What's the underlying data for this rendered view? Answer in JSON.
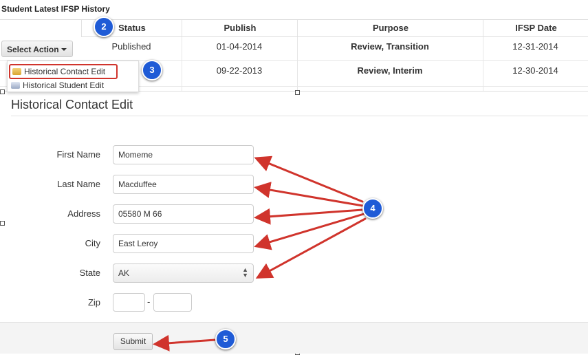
{
  "history": {
    "title": "Student Latest IFSP History",
    "columns": [
      "Status",
      "Publish",
      "Purpose",
      "IFSP Date"
    ],
    "rows": [
      {
        "status": "Published",
        "publish": "01-04-2014",
        "purpose": "Review, Transition",
        "ifsp_date": "12-31-2014"
      },
      {
        "status": "",
        "publish": "09-22-2013",
        "purpose": "Review, Interim",
        "ifsp_date": "12-30-2014"
      }
    ],
    "select_action_label": "Select Action",
    "menu_items": [
      "Historical Contact Edit",
      "Historical Student Edit"
    ]
  },
  "form": {
    "title": "Historical Contact Edit",
    "fields": {
      "first_name": {
        "label": "First Name",
        "value": "Momeme"
      },
      "last_name": {
        "label": "Last Name",
        "value": "Macduffee"
      },
      "address": {
        "label": "Address",
        "value": "05580 M 66"
      },
      "city": {
        "label": "City",
        "value": "East Leroy"
      },
      "state": {
        "label": "State",
        "value": "AK"
      },
      "zip": {
        "label": "Zip",
        "value1": "",
        "value2": "",
        "separator": "-"
      }
    },
    "submit_label": "Submit"
  },
  "callouts": {
    "step2": "2",
    "step3": "3",
    "step4": "4",
    "step5": "5"
  },
  "colors": {
    "badge": "#1f5bd6",
    "arrow": "#d0342c",
    "highlight": "#d0342c"
  }
}
